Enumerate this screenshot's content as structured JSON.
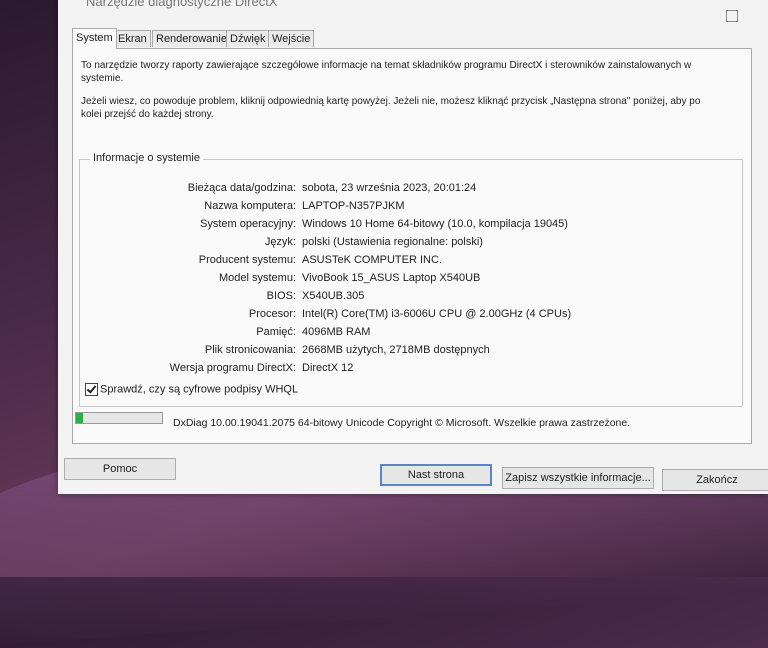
{
  "window": {
    "title": "Narzędzie diagnostyczne DirectX"
  },
  "tabs": [
    {
      "label": "System"
    },
    {
      "label": "Ekran"
    },
    {
      "label": "Renderowanie"
    },
    {
      "label": "Dźwięk"
    },
    {
      "label": "Wejście"
    }
  ],
  "intro": {
    "line1": "To narzędzie tworzy raporty zawierające szczegółowe informacje na temat składników programu DirectX i sterowników zainstalowanych w systemie.",
    "line2": "Jeżeli wiesz, co powoduje problem, kliknij odpowiednią kartę powyżej. Jeżeli nie, możesz kliknąć przycisk „Następna strona\" poniżej, aby po kolei przejść do każdej strony."
  },
  "system_info": {
    "group_title": "Informacje o systemie",
    "rows": [
      {
        "label": "Bieżąca data/godzina:",
        "value": "sobota, 23 września 2023, 20:01:24"
      },
      {
        "label": "Nazwa komputera:",
        "value": "LAPTOP-N357PJKM"
      },
      {
        "label": "System operacyjny:",
        "value": "Windows 10 Home 64-bitowy (10.0, kompilacja 19045)"
      },
      {
        "label": "Język:",
        "value": "polski (Ustawienia regionalne: polski)"
      },
      {
        "label": "Producent systemu:",
        "value": "ASUSTeK COMPUTER INC."
      },
      {
        "label": "Model systemu:",
        "value": "VivoBook 15_ASUS Laptop X540UB"
      },
      {
        "label": "BIOS:",
        "value": "X540UB.305"
      },
      {
        "label": "Procesor:",
        "value": "Intel(R) Core(TM) i3-6006U CPU @ 2.00GHz (4 CPUs)"
      },
      {
        "label": "Pamięć:",
        "value": "4096MB RAM"
      },
      {
        "label": "Plik stronicowania:",
        "value": "2668MB użytych, 2718MB dostępnych"
      },
      {
        "label": "Wersja programu DirectX:",
        "value": "DirectX 12"
      }
    ]
  },
  "whql_checkbox": {
    "label": "Sprawdź, czy są cyfrowe podpisy WHQL",
    "checked": true
  },
  "progress": {
    "value": 0.08
  },
  "version_text": "DxDiag 10.00.19041.2075 64-bitowy Unicode  Copyright © Microsoft. Wszelkie prawa zastrzeżone.",
  "buttons": {
    "help": "Pomoc",
    "next": "Nast strona",
    "save_all": "Zapisz wszystkie informacje...",
    "exit": "Zakończ"
  }
}
